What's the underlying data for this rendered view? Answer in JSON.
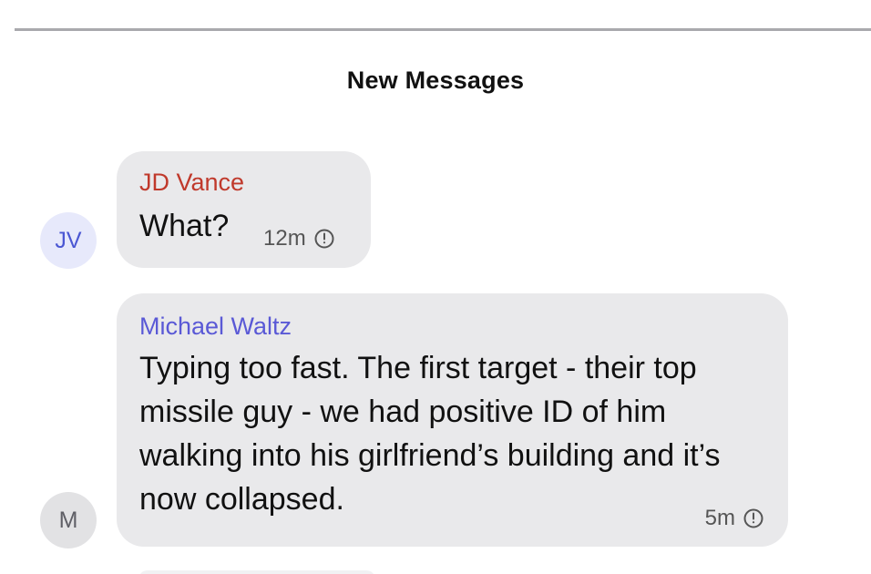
{
  "section": {
    "title": "New Messages"
  },
  "messages": [
    {
      "sender": "JD Vance",
      "sender_color": "#c0392b",
      "avatar_initials": "JV",
      "text": "What?",
      "time": "12m",
      "status_icon": "clock-icon"
    },
    {
      "sender": "Michael Waltz",
      "sender_color": "#5a59d6",
      "avatar_initials": "M",
      "text": "Typing too fast. The first target - their top missile guy - we had positive ID of him walking into his girlfriend’s building and it’s now collapsed.",
      "time": "5m",
      "status_icon": "clock-icon"
    }
  ]
}
